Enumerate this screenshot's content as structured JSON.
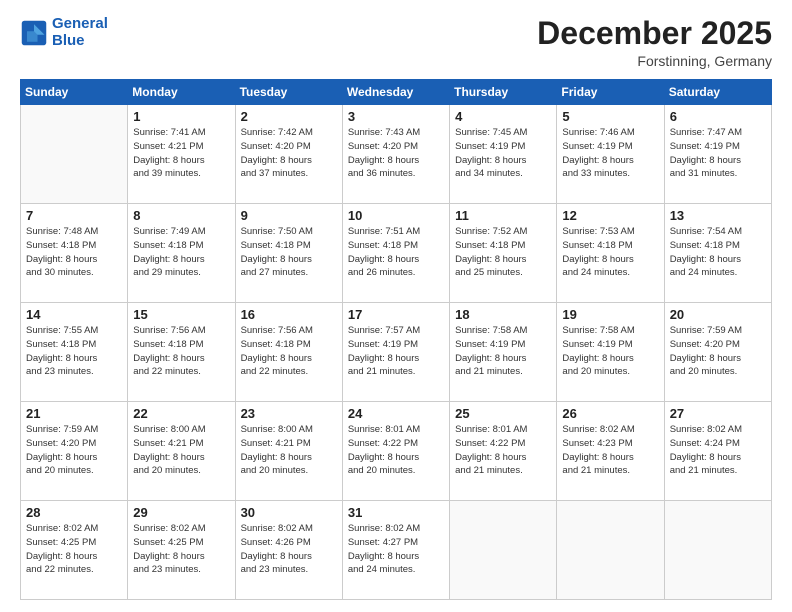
{
  "logo": {
    "line1": "General",
    "line2": "Blue"
  },
  "header": {
    "month": "December 2025",
    "location": "Forstinning, Germany"
  },
  "weekdays": [
    "Sunday",
    "Monday",
    "Tuesday",
    "Wednesday",
    "Thursday",
    "Friday",
    "Saturday"
  ],
  "weeks": [
    [
      {
        "day": "",
        "info": ""
      },
      {
        "day": "1",
        "info": "Sunrise: 7:41 AM\nSunset: 4:21 PM\nDaylight: 8 hours\nand 39 minutes."
      },
      {
        "day": "2",
        "info": "Sunrise: 7:42 AM\nSunset: 4:20 PM\nDaylight: 8 hours\nand 37 minutes."
      },
      {
        "day": "3",
        "info": "Sunrise: 7:43 AM\nSunset: 4:20 PM\nDaylight: 8 hours\nand 36 minutes."
      },
      {
        "day": "4",
        "info": "Sunrise: 7:45 AM\nSunset: 4:19 PM\nDaylight: 8 hours\nand 34 minutes."
      },
      {
        "day": "5",
        "info": "Sunrise: 7:46 AM\nSunset: 4:19 PM\nDaylight: 8 hours\nand 33 minutes."
      },
      {
        "day": "6",
        "info": "Sunrise: 7:47 AM\nSunset: 4:19 PM\nDaylight: 8 hours\nand 31 minutes."
      }
    ],
    [
      {
        "day": "7",
        "info": "Sunrise: 7:48 AM\nSunset: 4:18 PM\nDaylight: 8 hours\nand 30 minutes."
      },
      {
        "day": "8",
        "info": "Sunrise: 7:49 AM\nSunset: 4:18 PM\nDaylight: 8 hours\nand 29 minutes."
      },
      {
        "day": "9",
        "info": "Sunrise: 7:50 AM\nSunset: 4:18 PM\nDaylight: 8 hours\nand 27 minutes."
      },
      {
        "day": "10",
        "info": "Sunrise: 7:51 AM\nSunset: 4:18 PM\nDaylight: 8 hours\nand 26 minutes."
      },
      {
        "day": "11",
        "info": "Sunrise: 7:52 AM\nSunset: 4:18 PM\nDaylight: 8 hours\nand 25 minutes."
      },
      {
        "day": "12",
        "info": "Sunrise: 7:53 AM\nSunset: 4:18 PM\nDaylight: 8 hours\nand 24 minutes."
      },
      {
        "day": "13",
        "info": "Sunrise: 7:54 AM\nSunset: 4:18 PM\nDaylight: 8 hours\nand 24 minutes."
      }
    ],
    [
      {
        "day": "14",
        "info": "Sunrise: 7:55 AM\nSunset: 4:18 PM\nDaylight: 8 hours\nand 23 minutes."
      },
      {
        "day": "15",
        "info": "Sunrise: 7:56 AM\nSunset: 4:18 PM\nDaylight: 8 hours\nand 22 minutes."
      },
      {
        "day": "16",
        "info": "Sunrise: 7:56 AM\nSunset: 4:18 PM\nDaylight: 8 hours\nand 22 minutes."
      },
      {
        "day": "17",
        "info": "Sunrise: 7:57 AM\nSunset: 4:19 PM\nDaylight: 8 hours\nand 21 minutes."
      },
      {
        "day": "18",
        "info": "Sunrise: 7:58 AM\nSunset: 4:19 PM\nDaylight: 8 hours\nand 21 minutes."
      },
      {
        "day": "19",
        "info": "Sunrise: 7:58 AM\nSunset: 4:19 PM\nDaylight: 8 hours\nand 20 minutes."
      },
      {
        "day": "20",
        "info": "Sunrise: 7:59 AM\nSunset: 4:20 PM\nDaylight: 8 hours\nand 20 minutes."
      }
    ],
    [
      {
        "day": "21",
        "info": "Sunrise: 7:59 AM\nSunset: 4:20 PM\nDaylight: 8 hours\nand 20 minutes."
      },
      {
        "day": "22",
        "info": "Sunrise: 8:00 AM\nSunset: 4:21 PM\nDaylight: 8 hours\nand 20 minutes."
      },
      {
        "day": "23",
        "info": "Sunrise: 8:00 AM\nSunset: 4:21 PM\nDaylight: 8 hours\nand 20 minutes."
      },
      {
        "day": "24",
        "info": "Sunrise: 8:01 AM\nSunset: 4:22 PM\nDaylight: 8 hours\nand 20 minutes."
      },
      {
        "day": "25",
        "info": "Sunrise: 8:01 AM\nSunset: 4:22 PM\nDaylight: 8 hours\nand 21 minutes."
      },
      {
        "day": "26",
        "info": "Sunrise: 8:02 AM\nSunset: 4:23 PM\nDaylight: 8 hours\nand 21 minutes."
      },
      {
        "day": "27",
        "info": "Sunrise: 8:02 AM\nSunset: 4:24 PM\nDaylight: 8 hours\nand 21 minutes."
      }
    ],
    [
      {
        "day": "28",
        "info": "Sunrise: 8:02 AM\nSunset: 4:25 PM\nDaylight: 8 hours\nand 22 minutes."
      },
      {
        "day": "29",
        "info": "Sunrise: 8:02 AM\nSunset: 4:25 PM\nDaylight: 8 hours\nand 23 minutes."
      },
      {
        "day": "30",
        "info": "Sunrise: 8:02 AM\nSunset: 4:26 PM\nDaylight: 8 hours\nand 23 minutes."
      },
      {
        "day": "31",
        "info": "Sunrise: 8:02 AM\nSunset: 4:27 PM\nDaylight: 8 hours\nand 24 minutes."
      },
      {
        "day": "",
        "info": ""
      },
      {
        "day": "",
        "info": ""
      },
      {
        "day": "",
        "info": ""
      }
    ]
  ]
}
